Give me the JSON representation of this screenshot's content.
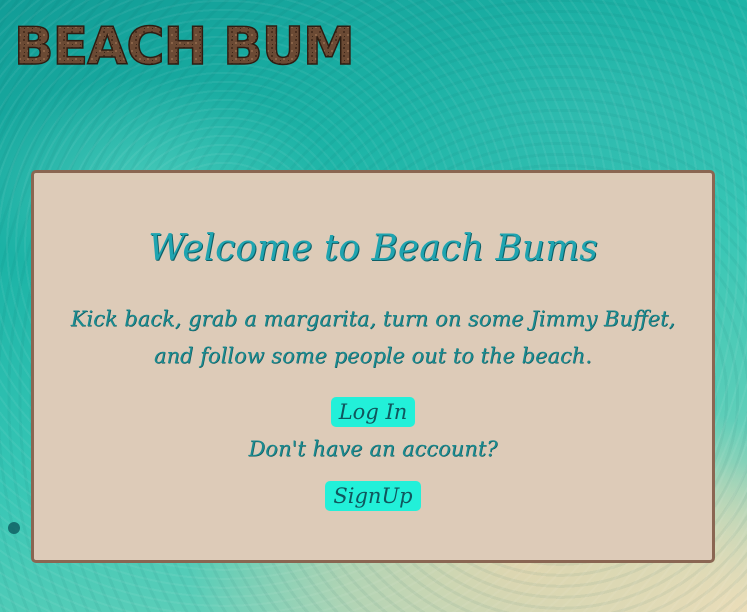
{
  "logo": {
    "text": "BEACH BUMS"
  },
  "card": {
    "title": "Welcome to Beach Bums",
    "intro": "Kick back, grab a margarita, turn on some Jimmy Buffet, and follow some people out to the beach.",
    "login_label": "Log In",
    "no_account_text": "Don't have an account?",
    "signup_label": "SignUp"
  },
  "colors": {
    "card_background": "#ddcbb8",
    "card_border": "#8a6652",
    "button_background": "#22f0d9",
    "text_teal": "#1f8b91",
    "logo_brown": "#6b4a34"
  }
}
